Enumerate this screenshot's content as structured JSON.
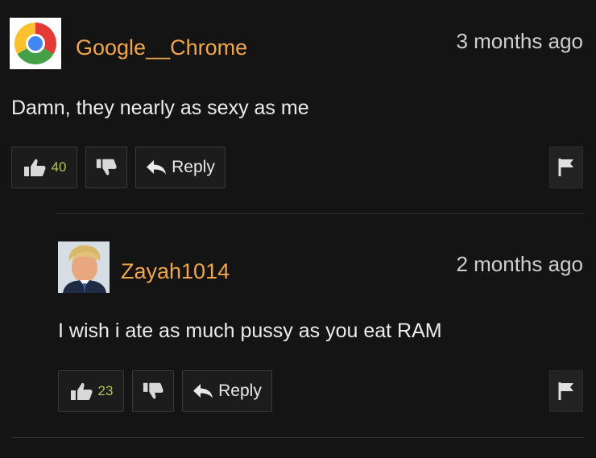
{
  "comments": [
    {
      "username": "Google__Chrome",
      "time": "3 months ago",
      "text": "Damn, they nearly as sexy as me",
      "likes": "40",
      "reply_label": "Reply",
      "avatar_icon": "chrome-logo"
    },
    {
      "username": "Zayah1014",
      "time": "2 months ago",
      "text": "I wish i ate as much pussy as you eat RAM",
      "likes": "23",
      "reply_label": "Reply",
      "avatar_icon": "profile-photo"
    }
  ],
  "colors": {
    "background": "#141414",
    "username": "#f0a64a",
    "like_count": "#b8c25a"
  }
}
